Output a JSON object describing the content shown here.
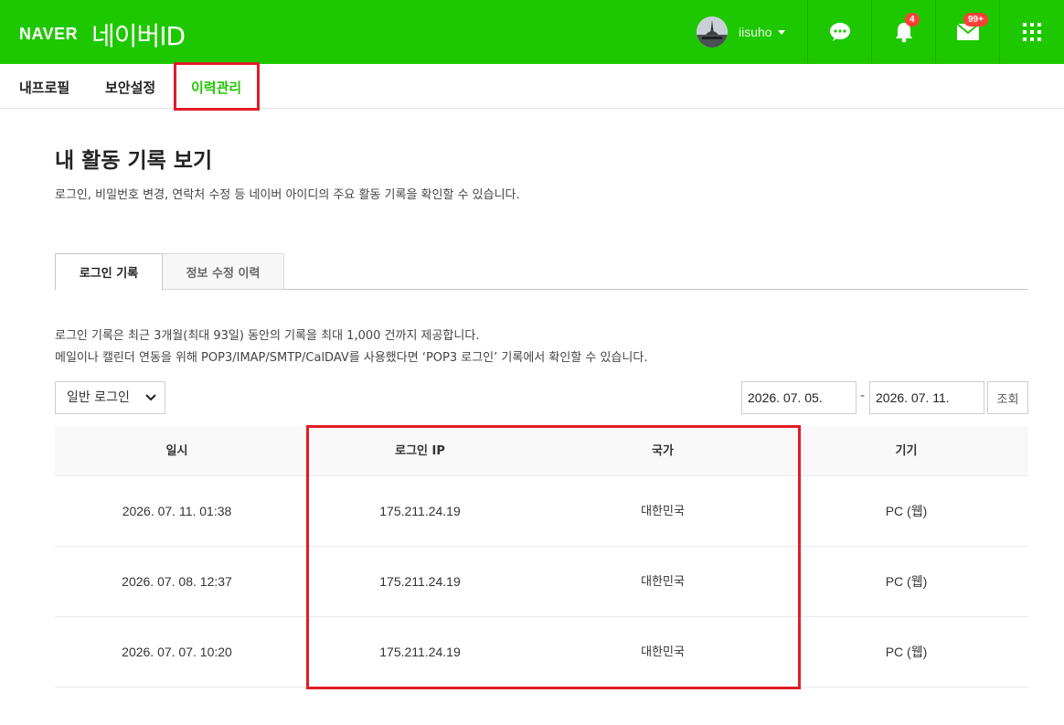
{
  "header": {
    "brand": "NAVER",
    "service_title": "네이버ID",
    "username": "iisuho",
    "notification_count": "4",
    "mail_count": "99+",
    "colors": {
      "brand_green": "#1ec800",
      "badge_red": "#ff4037",
      "highlight_red": "#e21c27"
    }
  },
  "nav": {
    "items": [
      {
        "label": "내프로필"
      },
      {
        "label": "보안설정"
      },
      {
        "label": "이력관리"
      }
    ],
    "active": "이력관리"
  },
  "page": {
    "title": "내 활동 기록 보기",
    "description": "로그인, 비밀번호 변경, 연락처 수정 등 네이버 아이디의 주요 활동 기록을 확인할 수 있습니다."
  },
  "tabs": [
    {
      "label": "로그인 기록",
      "active": true
    },
    {
      "label": "정보 수정 이력",
      "active": false
    }
  ],
  "notice": {
    "line1": "로그인 기록은 최근 3개월(최대 93일) 동안의 기록을 최대 1,000 건까지 제공합니다.",
    "line2": "메일이나 캘린더 연동을 위해 POP3/IMAP/SMTP/CalDAV를 사용했다면 ‘POP3 로그인’ 기록에서 확인할 수 있습니다."
  },
  "filter": {
    "type_selected": "일반 로그인",
    "date_from": "2026. 07. 05.",
    "date_separator": "-",
    "date_to": "2026. 07. 11.",
    "search_label": "조회"
  },
  "table": {
    "headers": [
      "일시",
      "로그인 IP",
      "국가",
      "기기"
    ],
    "rows": [
      {
        "datetime": "2026. 07. 11. 01:38",
        "ip": "175.211.24.19",
        "country": "대한민국",
        "device": "PC (웹)"
      },
      {
        "datetime": "2026. 07. 08. 12:37",
        "ip": "175.211.24.19",
        "country": "대한민국",
        "device": "PC (웹)"
      },
      {
        "datetime": "2026. 07. 07. 10:20",
        "ip": "175.211.24.19",
        "country": "대한민국",
        "device": "PC (웹)"
      }
    ]
  }
}
